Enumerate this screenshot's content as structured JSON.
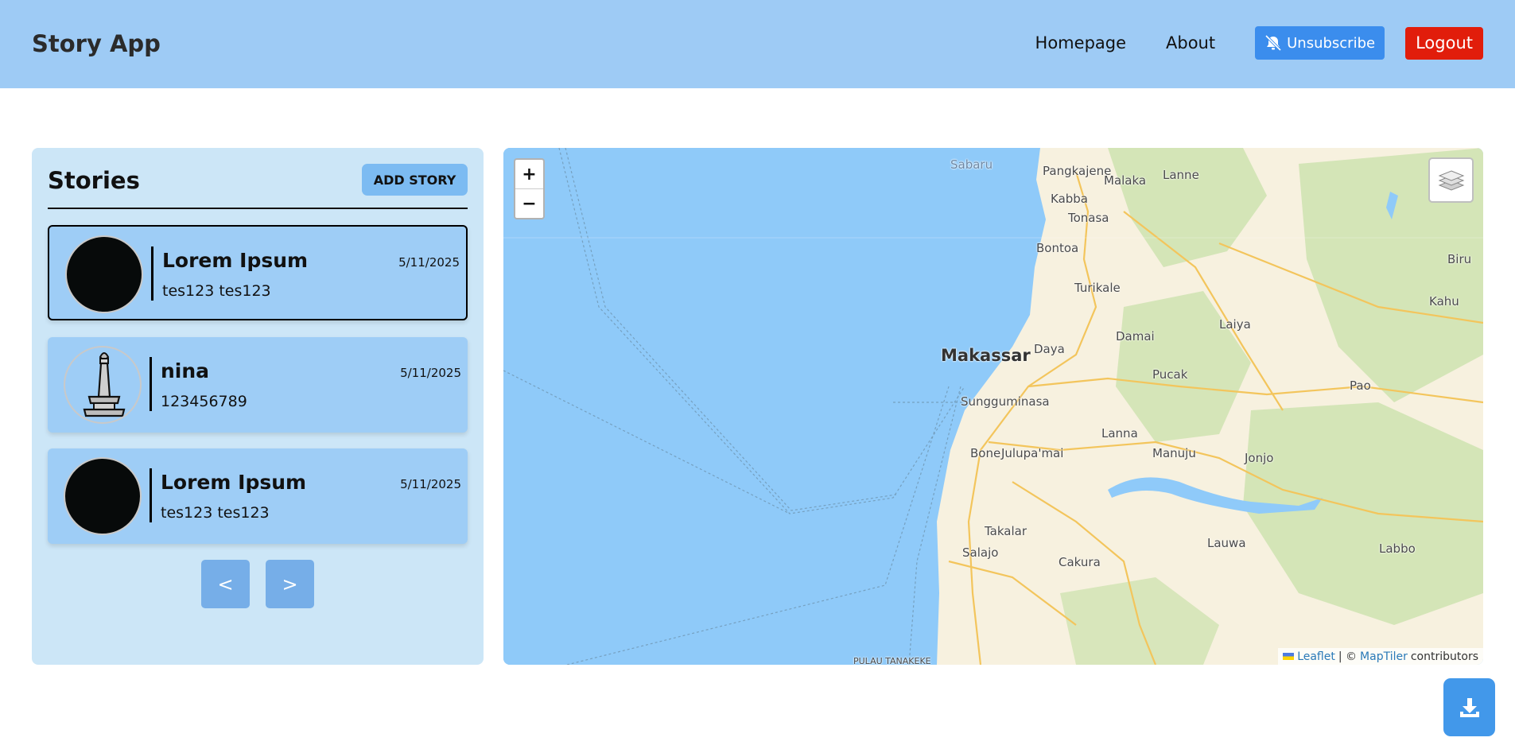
{
  "header": {
    "title": "Story App",
    "nav": {
      "homepage": "Homepage",
      "about": "About"
    },
    "unsubscribe_label": "Unsubscribe",
    "logout_label": "Logout"
  },
  "stories": {
    "heading": "Stories",
    "add_label": "ADD STORY",
    "items": [
      {
        "title": "Lorem Ipsum",
        "description": "tes123 tes123",
        "date": "5/11/2025",
        "image": "dark-photo",
        "selected": true
      },
      {
        "title": "nina",
        "description": "123456789",
        "date": "5/11/2025",
        "image": "monument-icon",
        "selected": false
      },
      {
        "title": "Lorem Ipsum",
        "description": "tes123 tes123",
        "date": "5/11/2025",
        "image": "dark-photo",
        "selected": false
      }
    ],
    "prev_label": "<",
    "next_label": ">"
  },
  "map": {
    "zoom_in": "+",
    "zoom_out": "−",
    "labels": {
      "sabaru": "Sabaru",
      "pangkajene": "Pangkajene",
      "malaka": "Malaka",
      "lanne": "Lanne",
      "kabba": "Kabba",
      "tonasa": "Tonasa",
      "bontoa": "Bontoa",
      "biru": "Biru",
      "turikale": "Turikale",
      "kahu": "Kahu",
      "laiya": "Laiya",
      "damai": "Damai",
      "daya": "Daya",
      "makassar": "Makassar",
      "pucak": "Pucak",
      "pao": "Pao",
      "sungguminasa": "Sungguminasa",
      "lanna": "Lanna",
      "bone": "Bone",
      "julupamai": "Julupa'mai",
      "manuju": "Manuju",
      "jonjo": "Jonjo",
      "takalar": "Takalar",
      "salajo": "Salajo",
      "lauwa": "Lauwa",
      "labbo": "Labbo",
      "cakura": "Cakura",
      "pulau": "PULAU TANAKEKE"
    },
    "attribution": {
      "leaflet": "Leaflet",
      "sep": "| ©",
      "maptiler": "MapTiler",
      "contributors": "contributors"
    },
    "colors": {
      "water": "#8fcaf9",
      "land": "#f7f1df",
      "forest": "#cfe3b2",
      "road": "#f6c75a"
    }
  }
}
